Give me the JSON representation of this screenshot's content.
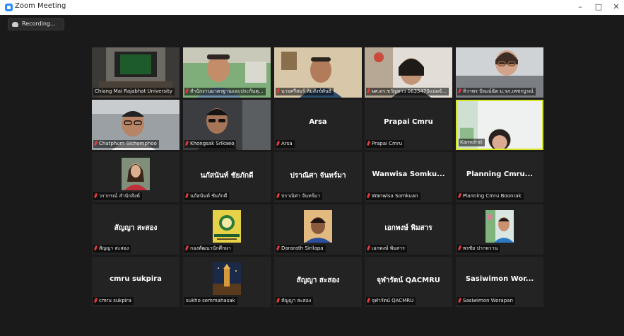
{
  "window": {
    "title": "Zoom Meeting",
    "minimize": "–",
    "maximize": "□",
    "close": "✕"
  },
  "recording": {
    "label": "Recording..."
  },
  "participants": [
    {
      "label": "Chiang Mai Rajabhat University",
      "name": "",
      "video": "room",
      "muted": false,
      "active": false
    },
    {
      "label": "สำนักงานมาตรฐานและประกันคุ...",
      "name": "",
      "video": "person-green",
      "muted": true,
      "active": false
    },
    {
      "label": "นายศรีสมร์ ลิมสังข์พันธ์",
      "name": "",
      "video": "person-beige",
      "muted": true,
      "active": false
    },
    {
      "label": "ผศ.ดร.ขวัญดาว 0635470แม่ผจั...",
      "name": "",
      "video": "person-office",
      "muted": true,
      "active": false
    },
    {
      "label": "ทิวาพร ปัณณ์ฉัต ม.รภ.เพชรบูรณ์",
      "name": "",
      "video": "person-glasses",
      "muted": true,
      "active": false
    },
    {
      "label": "Chatphum Sichomphoo",
      "name": "",
      "video": "person-gray",
      "muted": true,
      "active": false
    },
    {
      "label": "Khongsak Srikaeo",
      "name": "",
      "video": "person-dark",
      "muted": true,
      "active": false
    },
    {
      "label": "Arsa",
      "name": "Arsa",
      "video": "none",
      "muted": true,
      "active": false
    },
    {
      "label": "Prapai Cmru",
      "name": "Prapai Cmru",
      "video": "none",
      "muted": true,
      "active": false
    },
    {
      "label": "Kamolrat",
      "name": "",
      "video": "person-white",
      "muted": false,
      "active": true
    },
    {
      "label": "วรากรณ์ ลำนักสิงห์",
      "name": "",
      "video": "thumb-woman",
      "muted": true,
      "active": false
    },
    {
      "label": "นภัสนันท์ ชัยภักดี",
      "name": "นภัสนันท์ ชัยภักดี",
      "video": "none",
      "muted": true,
      "active": false
    },
    {
      "label": "ปราณิศา จันทร์มา",
      "name": "ปราณิศา จันทร์มา",
      "video": "none",
      "muted": true,
      "active": false
    },
    {
      "label": "Wanwisa Somkuan",
      "name": "Wanwisa Somku...",
      "video": "none",
      "muted": true,
      "active": false
    },
    {
      "label": "Planning Cmru Boonrak",
      "name": "Planning Cmru...",
      "video": "none",
      "muted": true,
      "active": false
    },
    {
      "label": "สัญญา สะสอง",
      "name": "สัญญา สะสอง",
      "video": "none",
      "muted": true,
      "active": false
    },
    {
      "label": "กองพัฒนานักศึกษา",
      "name": "",
      "video": "thumb-logo",
      "muted": true,
      "active": false
    },
    {
      "label": "Dararath Sirilapa",
      "name": "",
      "video": "thumb-woman2",
      "muted": true,
      "active": false
    },
    {
      "label": "เอกพงษ์ พิมสาร",
      "name": "เอกพงษ์ พิมสาร",
      "video": "none",
      "muted": true,
      "active": false
    },
    {
      "label": "พรชัย ปากหวาน",
      "name": "",
      "video": "thumb-man",
      "muted": true,
      "active": false
    },
    {
      "label": "cmru sukpira",
      "name": "cmru sukpira",
      "video": "none",
      "muted": true,
      "active": false
    },
    {
      "label": "sukho semmahasak",
      "name": "",
      "video": "thumb-night",
      "muted": false,
      "active": false
    },
    {
      "label": "สัญญา สะสอง",
      "name": "สัญญา สะสอง",
      "video": "none",
      "muted": true,
      "active": false
    },
    {
      "label": "จุฬารัตน์ QACMRU",
      "name": "จุฬารัตน์ QACMRU",
      "video": "none",
      "muted": true,
      "active": false
    },
    {
      "label": "Sasiwimon Worapan",
      "name": "Sasiwimon Wor...",
      "video": "none",
      "muted": true,
      "active": false
    }
  ],
  "colors": {
    "background": "#1a1a1a",
    "tile": "#232323",
    "active_border": "#d6e62a",
    "muted_icon": "#e23c3c"
  }
}
